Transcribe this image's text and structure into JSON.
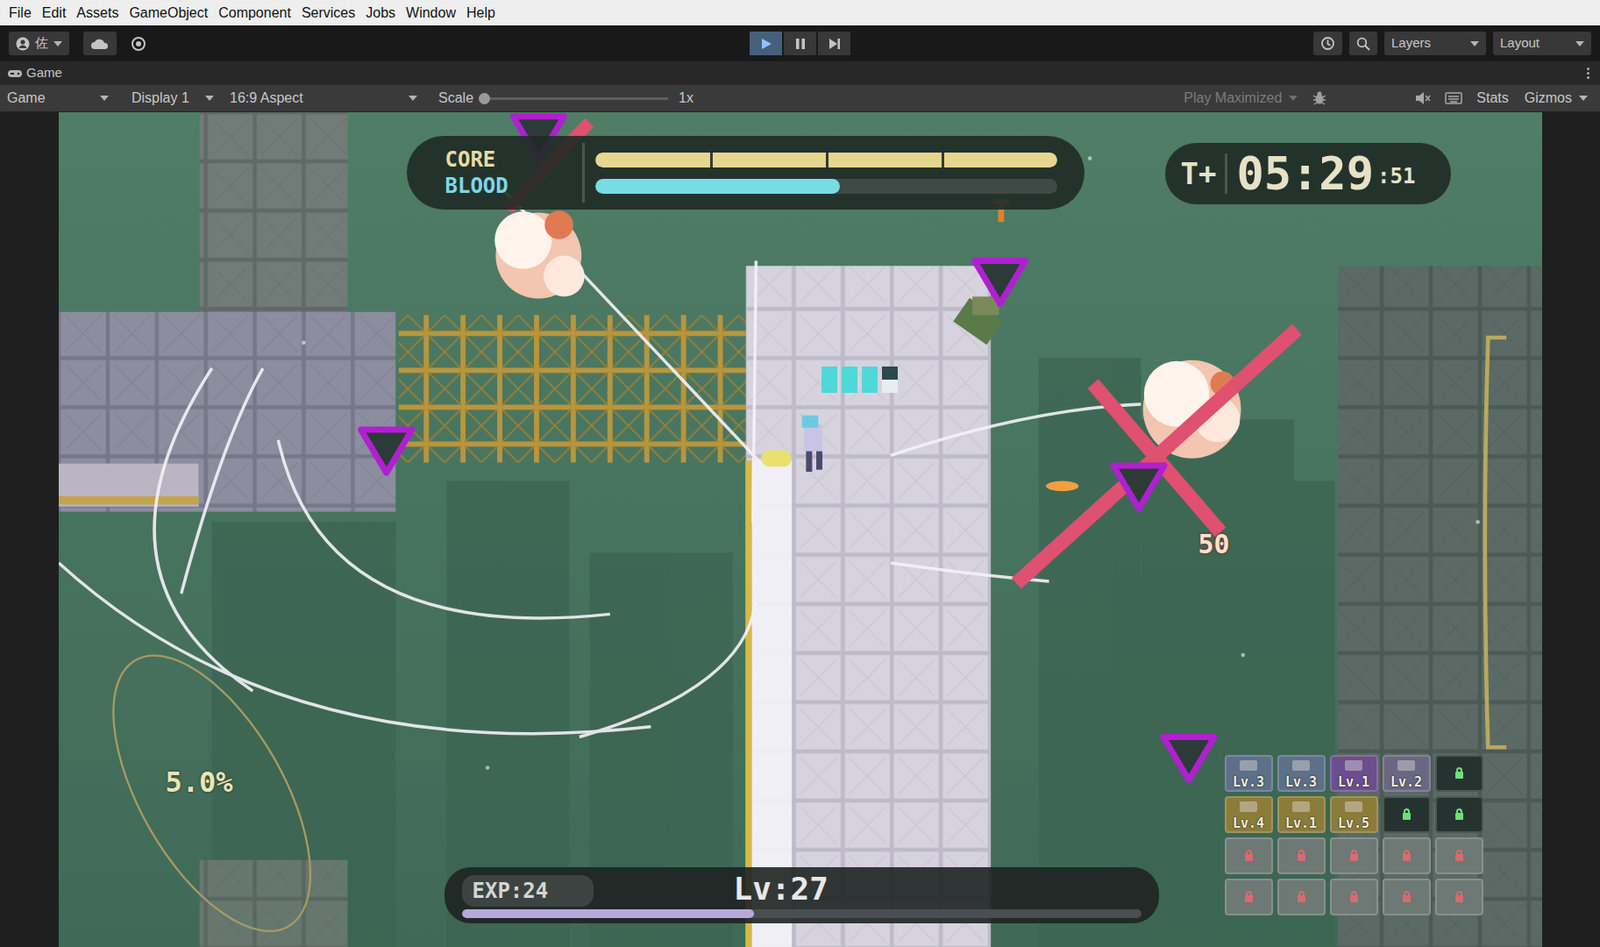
{
  "menu": [
    "File",
    "Edit",
    "Assets",
    "GameObject",
    "Component",
    "Services",
    "Jobs",
    "Window",
    "Help"
  ],
  "toolbar": {
    "account": "佐",
    "play": {
      "selected": true
    },
    "pause": {
      "selected": false
    },
    "step": {
      "selected": false
    },
    "layers": "Layers",
    "layout": "Layout"
  },
  "tab": {
    "label": "Game"
  },
  "game_bar": {
    "view": "Game",
    "display": "Display 1",
    "aspect": "16:9 Aspect",
    "scale": {
      "label": "Scale",
      "level": 0,
      "reading": "1x"
    },
    "play_maximized": {
      "label": "Play Maximized",
      "disabled": true
    },
    "stats": "Stats",
    "gizmos": "Gizmos"
  },
  "hud": {
    "core": {
      "label": "CORE",
      "level": 1
    },
    "blood": {
      "label": "BLOOD",
      "level": 0.53
    },
    "timer": {
      "prefix": "T+",
      "time": "05:29",
      "fraction": ":51"
    },
    "charge": "5.0%",
    "exp": {
      "label": "EXP:24",
      "level": 0.43
    },
    "player_level": "Lv:27",
    "ammo": [
      {
        "level": 1
      },
      {
        "level": 1
      },
      {
        "level": 1
      },
      {
        "level": 0.5
      }
    ],
    "damage": "50",
    "skills": [
      {
        "kind": "skill",
        "label": "Lv.3",
        "color": "#5d7088"
      },
      {
        "kind": "skill",
        "label": "Lv.3",
        "color": "#5d7088"
      },
      {
        "kind": "skill",
        "label": "Lv.1",
        "color": "#6c4e90"
      },
      {
        "kind": "skill",
        "label": "Lv.2",
        "color": "#6a6782"
      },
      {
        "kind": "open"
      },
      {
        "kind": "skill",
        "label": "Lv.4",
        "color": "#8c7c3a"
      },
      {
        "kind": "skill",
        "label": "Lv.1",
        "color": "#8c7c3a"
      },
      {
        "kind": "skill",
        "label": "Lv.5",
        "color": "#8c7c3a"
      },
      {
        "kind": "open"
      },
      {
        "kind": "open"
      },
      {
        "kind": "locked"
      },
      {
        "kind": "locked"
      },
      {
        "kind": "locked"
      },
      {
        "kind": "locked"
      },
      {
        "kind": "locked"
      },
      {
        "kind": "locked"
      },
      {
        "kind": "locked"
      },
      {
        "kind": "locked"
      },
      {
        "kind": "locked"
      },
      {
        "kind": "locked"
      }
    ]
  }
}
